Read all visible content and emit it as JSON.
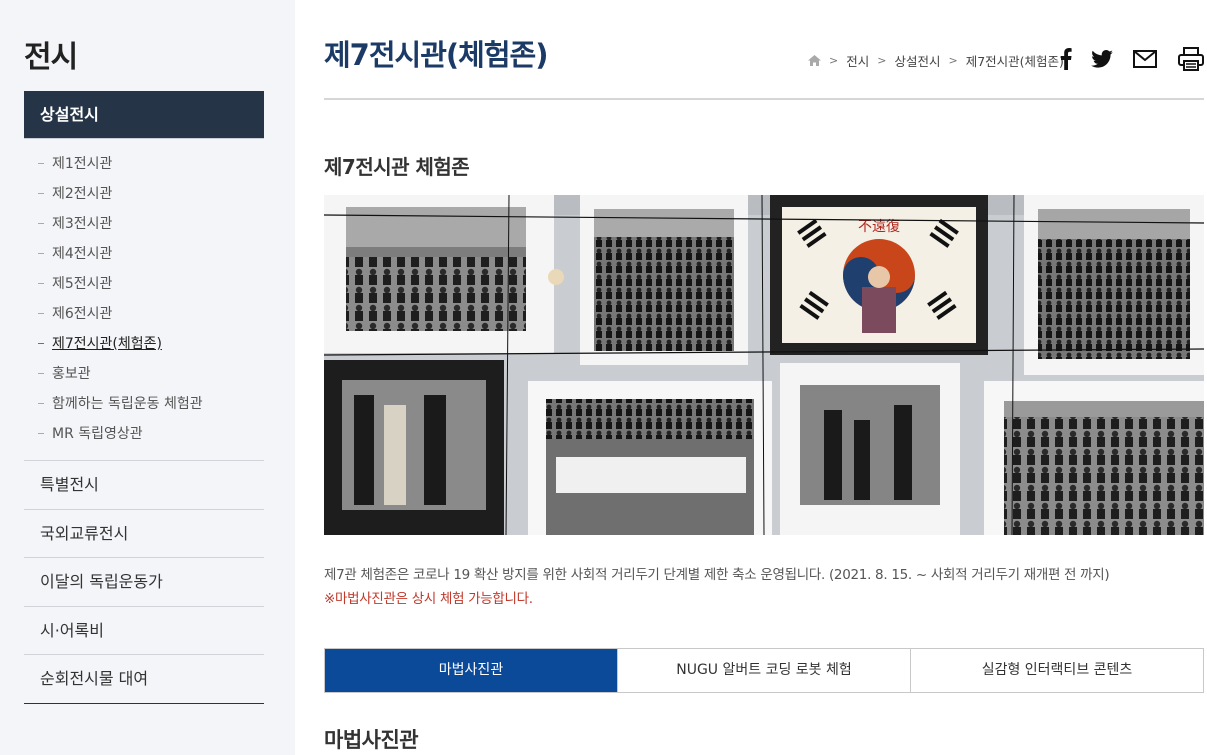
{
  "sidebar": {
    "title": "전시",
    "active": "상설전시",
    "sub_items": [
      {
        "label": "제1전시관"
      },
      {
        "label": "제2전시관"
      },
      {
        "label": "제3전시관"
      },
      {
        "label": "제4전시관"
      },
      {
        "label": "제5전시관"
      },
      {
        "label": "제6전시관"
      },
      {
        "label": "제7전시관(체험존)"
      },
      {
        "label": "홍보관"
      },
      {
        "label": "함께하는 독립운동 체험관"
      },
      {
        "label": "MR 독립영상관"
      }
    ],
    "active_sub_index": 6,
    "main_items": [
      {
        "label": "특별전시"
      },
      {
        "label": "국외교류전시"
      },
      {
        "label": "이달의 독립운동가"
      },
      {
        "label": "시·어록비"
      },
      {
        "label": "순회전시물 대여"
      }
    ]
  },
  "header": {
    "title": "제7전시관(체험존)",
    "breadcrumb": [
      "전시",
      "상설전시",
      "제7전시관(체험존)"
    ],
    "share_icons": [
      "facebook-icon",
      "twitter-icon",
      "mail-icon",
      "print-icon"
    ]
  },
  "content": {
    "section_title": "제7전시관 체험존",
    "notice": "제7관 체험존은 코로나 19 확산 방지를 위한 사회적 거리두기 단계별 제한 축소 운영됩니다. (2021. 8. 15. ~ 사회적 거리두기 재개편 전 까지)",
    "notice_red": "※마법사진관은 상시 체험 가능합니다.",
    "tabs": [
      {
        "label": "마법사진관"
      },
      {
        "label": "NUGU 알버트 코딩 로봇 체험"
      },
      {
        "label": "실감형 인터랙티브 콘텐츠"
      }
    ],
    "active_tab_index": 0,
    "bottom_title": "마법사진관",
    "photo_sign": "不遠復"
  },
  "colors": {
    "sidebar_bg": "#f3f5f8",
    "sidebar_active": "#263447",
    "title_blue": "#1c3a66",
    "tab_active": "#0b4a98",
    "notice_red": "#c0392b"
  }
}
